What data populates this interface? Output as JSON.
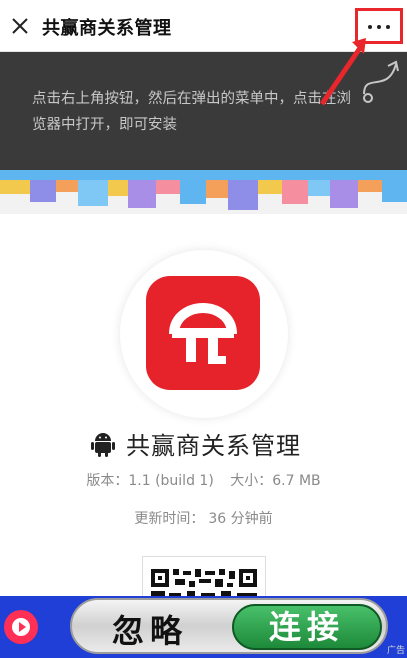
{
  "topbar": {
    "close_icon": "close-icon",
    "title": "共赢商关系管理",
    "more_icon": "more-horizontal-icon"
  },
  "overlay": {
    "instruction": "点击右上角按钮，然后在弹出的菜单中，点击在浏览器中打开，即可安装",
    "curl_icon": "curved-arrow-icon"
  },
  "app": {
    "name": "共赢商关系管理",
    "version_label": "版本：",
    "version": "1.1 (build 1)",
    "size_label": "大小：",
    "size": "6.7 MB",
    "updated_label": "更新时间：",
    "updated": "36 分钟前",
    "platform_icon": "android-icon"
  },
  "ad": {
    "ignore": "忽略",
    "connect": "连接",
    "tag": "广告"
  },
  "colors": {
    "accent_red": "#e6232a",
    "highlight_red": "#e8262b",
    "overlay_bg": "#3a3a3a",
    "ad_blue": "#1f3fd6",
    "connect_green": "#2aa34c"
  }
}
